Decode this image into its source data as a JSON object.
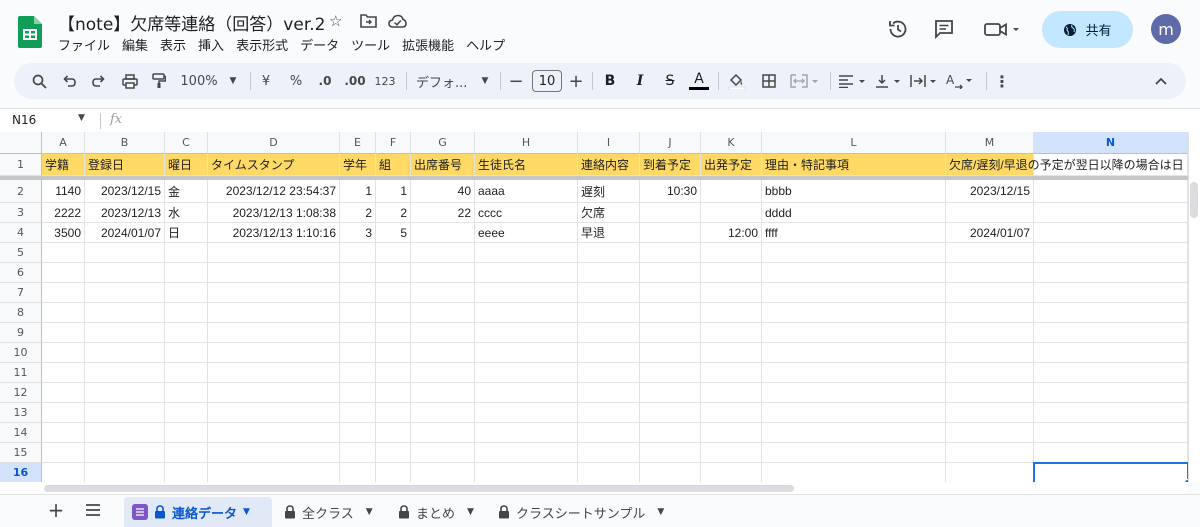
{
  "title_bar": {
    "doc_title": "【note】欠席等連絡（回答）ver.2",
    "share_label": "共有",
    "avatar_letter": "m"
  },
  "menu": [
    "ファイル",
    "編集",
    "表示",
    "挿入",
    "表示形式",
    "データ",
    "ツール",
    "拡張機能",
    "ヘルプ"
  ],
  "toolbar": {
    "zoom": "100%",
    "currency": "¥",
    "percent": "%",
    "dec_decrease": ".0",
    "dec_increase": ".00",
    "number_format": "123",
    "font": "デフォ...",
    "font_size": "10"
  },
  "formula_bar": {
    "cell_ref": "N16",
    "fx": "fx"
  },
  "columns": [
    "A",
    "B",
    "C",
    "D",
    "E",
    "F",
    "G",
    "H",
    "I",
    "J",
    "K",
    "L",
    "M",
    "N"
  ],
  "selected_column": "N",
  "rows": [
    "1",
    "2",
    "3",
    "4",
    "5",
    "6",
    "7",
    "8",
    "9",
    "10",
    "11",
    "12",
    "13",
    "14",
    "15",
    "16"
  ],
  "selected_row": "16",
  "header_row": [
    "学籍",
    "登録日",
    "曜日",
    "タイムスタンプ",
    "学年",
    "組",
    "出席番号",
    "生徒氏名",
    "連絡内容",
    "到着予定",
    "出発予定",
    "理由・特記事項",
    "欠席/遅刻/早退の予定が翌日以降の場合は日",
    ""
  ],
  "data_rows": [
    [
      "1140",
      "2023/12/15",
      "金",
      "2023/12/12 23:54:37",
      "1",
      "1",
      "40",
      "aaaa",
      "遅刻",
      "10:30",
      "",
      "bbbb",
      "2023/12/15",
      ""
    ],
    [
      "2222",
      "2023/12/13",
      "水",
      "2023/12/13 1:08:38",
      "2",
      "2",
      "22",
      "cccc",
      "欠席",
      "",
      "",
      "dddd",
      "",
      ""
    ],
    [
      "3500",
      "2024/01/07",
      "日",
      "2023/12/13 1:10:16",
      "3",
      "5",
      "",
      "eeee",
      "早退",
      "",
      "12:00",
      "ffff",
      "2024/01/07",
      ""
    ]
  ],
  "sheet_tabs": [
    {
      "label": "連絡データ",
      "active": true
    },
    {
      "label": "全クラス",
      "active": false
    },
    {
      "label": "まとめ",
      "active": false
    },
    {
      "label": "クラスシートサンプル",
      "active": false
    }
  ],
  "colors": {
    "header_fill": "#ffd966",
    "accent": "#1a73e8",
    "share_bg": "#c2e7ff"
  }
}
